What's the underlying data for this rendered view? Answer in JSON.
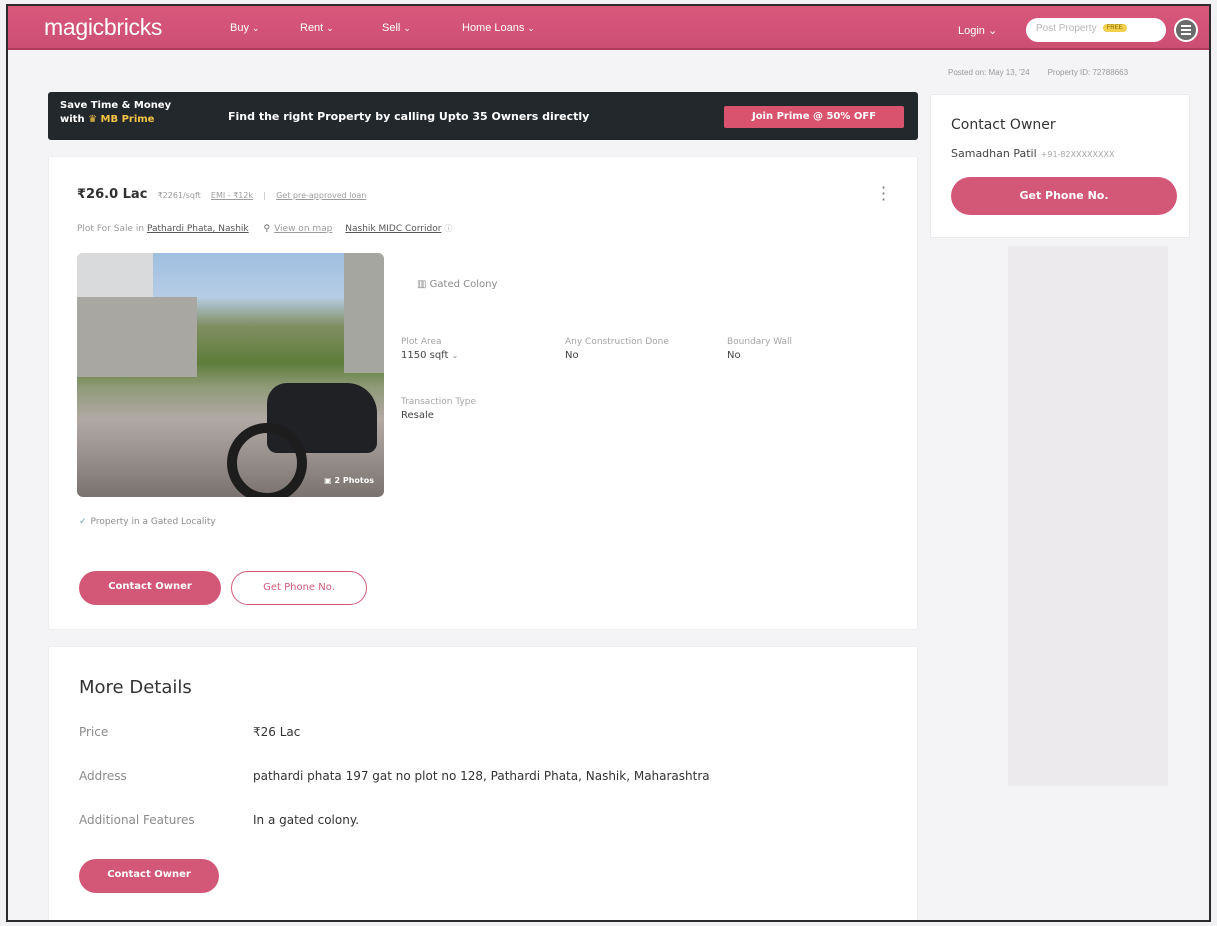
{
  "header": {
    "logo": "magicbricks",
    "nav": [
      "Buy",
      "Rent",
      "Sell",
      "Home Loans"
    ],
    "login": "Login",
    "post_property": "Post Property",
    "free_badge": "FREE"
  },
  "meta": {
    "posted_on": "Posted on: May 13, '24",
    "property_id": "Property ID: 72788663"
  },
  "prime": {
    "line1": "Save Time & Money",
    "line2_prefix": "with",
    "line2_brand": "MB Prime",
    "message": "Find the right Property by calling Upto 35 Owners directly",
    "cta": "Join Prime @ 50% OFF"
  },
  "contact_card": {
    "title": "Contact Owner",
    "owner_name": "Samadhan Patil",
    "phone_masked": "+91-82XXXXXXXX",
    "button": "Get Phone No."
  },
  "listing": {
    "price": "₹26.0 Lac",
    "rate": "₹2261/sqft",
    "emi": "EMI - ₹12k",
    "loan_link": "Get pre-approved loan",
    "location_prefix": "Plot For Sale in",
    "location": "Pathardi Phata, Nashik",
    "view_map": "View on map",
    "corridor": "Nashik MIDC Corridor",
    "photos_tag": "2 Photos",
    "feature": "Gated Colony",
    "attributes": [
      {
        "key": "Plot Area",
        "value": "1150 sqft"
      },
      {
        "key": "Any Construction Done",
        "value": "No"
      },
      {
        "key": "Boundary Wall",
        "value": "No"
      },
      {
        "key": "Transaction Type",
        "value": "Resale"
      }
    ],
    "gated_note": "Property in a Gated Locality",
    "contact_button": "Contact Owner",
    "phone_button": "Get Phone No."
  },
  "more_details": {
    "title": "More Details",
    "rows": [
      {
        "key": "Price",
        "value": "₹26 Lac"
      },
      {
        "key": "Address",
        "value": "pathardi phata 197 gat no plot no 128, Pathardi Phata, Nashik, Maharashtra"
      },
      {
        "key": "Additional Features",
        "value": "In a gated colony."
      }
    ],
    "button": "Contact Owner"
  }
}
